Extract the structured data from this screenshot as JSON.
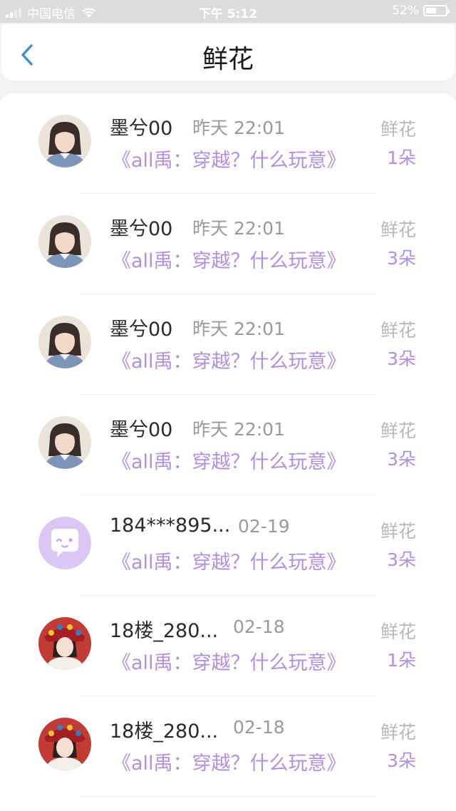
{
  "status_bar": {
    "carrier": "中国电信",
    "time": "下午 5:12",
    "battery": "52%",
    "battery_level": 0.52
  },
  "nav": {
    "back_icon": "chevron-left-icon",
    "title": "鲜花"
  },
  "colors": {
    "accent": "#b48fe0",
    "back": "#2f8fe0"
  },
  "items": [
    {
      "name": "墨兮00",
      "time": "昨天 22:01",
      "book": "《all禹：穿越？什么玩意》",
      "gift": "鲜花",
      "count": "1朵",
      "avatar": "user-photo-girl-denim"
    },
    {
      "name": "墨兮00",
      "time": "昨天 22:01",
      "book": "《all禹：穿越？什么玩意》",
      "gift": "鲜花",
      "count": "3朵",
      "avatar": "user-photo-girl-denim"
    },
    {
      "name": "墨兮00",
      "time": "昨天 22:01",
      "book": "《all禹：穿越？什么玩意》",
      "gift": "鲜花",
      "count": "3朵",
      "avatar": "user-photo-girl-denim"
    },
    {
      "name": "墨兮00",
      "time": "昨天 22:01",
      "book": "《all禹：穿越？什么玩意》",
      "gift": "鲜花",
      "count": "3朵",
      "avatar": "user-photo-girl-denim"
    },
    {
      "name": "184***895...",
      "time": "02-19",
      "book": "《all禹：穿越？什么玩意》",
      "gift": "鲜花",
      "count": "3朵",
      "avatar": "default-chat-bubble-avatar"
    },
    {
      "name": "18楼_280...",
      "time": "02-18",
      "book": "《all禹：穿越？什么玩意》",
      "gift": "鲜花",
      "count": "1朵",
      "avatar": "user-photo-girl-red-headdress"
    },
    {
      "name": "18楼_280...",
      "time": "02-18",
      "book": "《all禹：穿越？什么玩意》",
      "gift": "鲜花",
      "count": "3朵",
      "avatar": "user-photo-girl-red-headdress"
    }
  ]
}
